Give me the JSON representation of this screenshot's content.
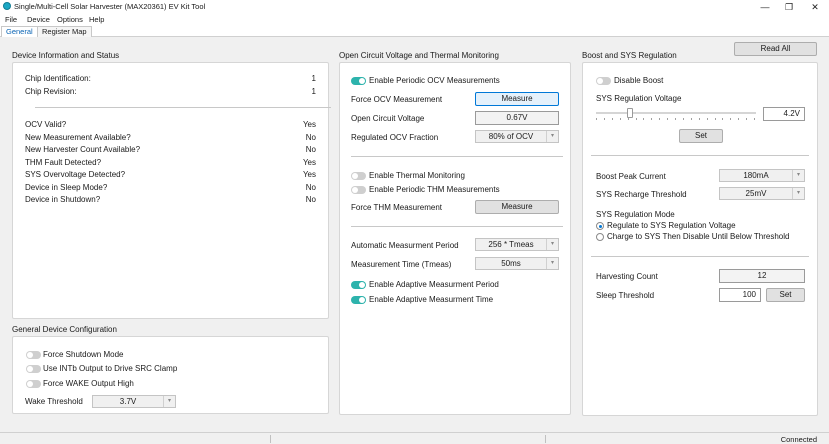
{
  "window": {
    "title": "Single/Multi-Cell Solar Harvester (MAX20361) EV Kit Tool",
    "controls": {
      "minimize": "—",
      "maximize": "❐",
      "close": "✕"
    }
  },
  "menu": [
    "File",
    "Device",
    "Options",
    "Help"
  ],
  "tabs": [
    "General",
    "Register Map"
  ],
  "device_info": {
    "title": "Device Information and Status",
    "chip_id_label": "Chip Identification:",
    "chip_id_value": "1",
    "chip_rev_label": "Chip Revision:",
    "chip_rev_value": "1",
    "status": [
      {
        "label": "OCV Valid?",
        "value": "Yes"
      },
      {
        "label": "New  Measurement Available?",
        "value": "No"
      },
      {
        "label": "New Harvester Count Available?",
        "value": "No"
      },
      {
        "label": "THM Fault Detected?",
        "value": "Yes"
      },
      {
        "label": "SYS Overvoltage Detected?",
        "value": "Yes"
      },
      {
        "label": "Device in Sleep Mode?",
        "value": "No"
      },
      {
        "label": "Device in Shutdown?",
        "value": "No"
      }
    ]
  },
  "general_config": {
    "title": "General Device Configuration",
    "force_shutdown": "Force Shutdown Mode",
    "use_intb": "Use INTb Output to Drive SRC Clamp",
    "force_wake": "Force WAKE Output High",
    "wake_threshold_label": "Wake Threshold",
    "wake_threshold_value": "3.7V"
  },
  "ocv": {
    "title": "Open Circuit Voltage and Thermal Monitoring",
    "enable_periodic_ocv": "Enable Periodic OCV Measurements",
    "force_ocv_label": "Force OCV Measurement",
    "measure_label": "Measure",
    "ocv_label": "Open Circuit Voltage",
    "ocv_value": "0.67V",
    "reg_ocv_label": "Regulated OCV Fraction",
    "reg_ocv_value": "80% of OCV",
    "enable_thermal": "Enable Thermal Monitoring",
    "enable_periodic_thm": "Enable Periodic THM Measurements",
    "force_thm_label": "Force THM Measurement",
    "measure_thm_label": "Measure",
    "auto_period_label": "Automatic Measurment Period",
    "auto_period_value": "256 * Tmeas",
    "meas_time_label": "Measurement Time (Tmeas)",
    "meas_time_value": "50ms",
    "adaptive_period": "Enable Adaptive Measurment Period",
    "adaptive_time": "Enable Adaptive Measurment Time"
  },
  "boost": {
    "title": "Boost and SYS Regulation",
    "read_all": "Read All",
    "disable_boost": "Disable Boost",
    "sys_reg_voltage_label": "SYS Regulation Voltage",
    "sys_reg_voltage_value": "4.2V",
    "slider_level": 0.2,
    "set_label": "Set",
    "peak_current_label": "Boost Peak Current",
    "peak_current_value": "180mA",
    "recharge_label": "SYS Recharge Threshold",
    "recharge_value": "25mV",
    "reg_mode_label": "SYS Regulation Mode",
    "reg_mode_opt1": "Regulate to SYS Regulation Voltage",
    "reg_mode_opt2": "Charge to SYS Then Disable Until Below Threshold",
    "harvest_count_label": "Harvesting Count",
    "harvest_count_value": "12",
    "sleep_label": "Sleep Threshold",
    "sleep_value": "100",
    "sleep_set_label": "Set"
  },
  "status": {
    "connection": "Connected"
  },
  "colors": {
    "accent": "#0078d7",
    "toggle_on": "#2db3ac",
    "toggle_off": "#cfcfcf"
  }
}
